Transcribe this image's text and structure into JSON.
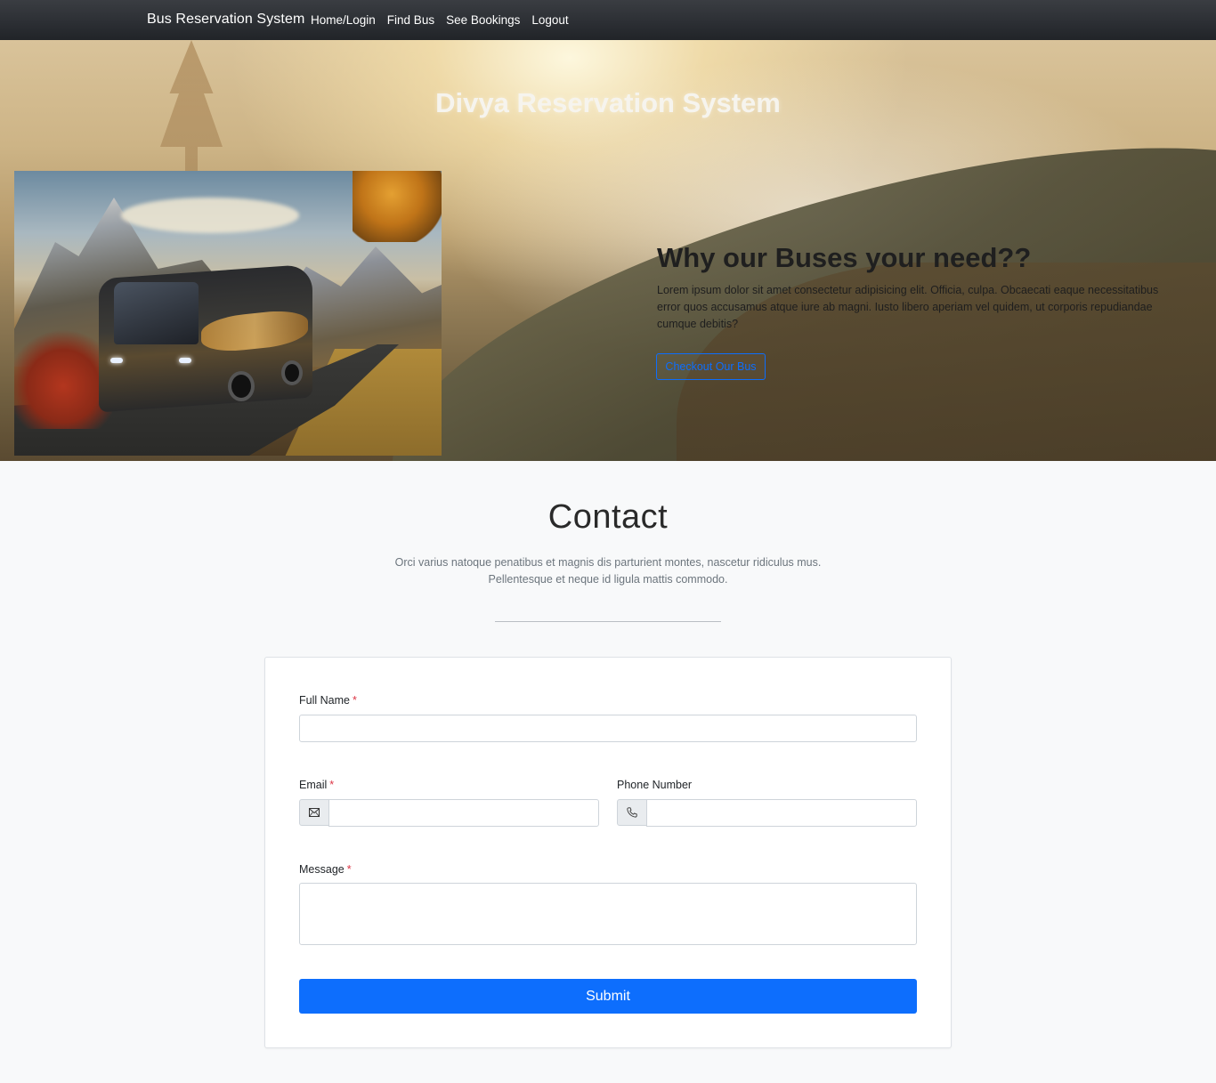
{
  "navbar": {
    "brand": "Bus Reservation System",
    "links": [
      "Home/Login",
      "Find Bus",
      "See Bookings",
      "Logout"
    ]
  },
  "hero": {
    "title": "Divya Reservation System",
    "why_title": "Why our Buses your need??",
    "why_text": "Lorem ipsum dolor sit amet consectetur adipisicing elit. Officia, culpa. Obcaecati eaque necessitatibus error quos accusamus atque iure ab magni. Iusto libero aperiam vel quidem, ut corporis repudiandae cumque debitis?",
    "button_label": "Checkout Our Bus"
  },
  "contact": {
    "title": "Contact",
    "subtitle_line1": "Orci varius natoque penatibus et magnis dis parturient montes, nascetur ridiculus mus.",
    "subtitle_line2": "Pellentesque et neque id ligula mattis commodo.",
    "form": {
      "full_name_label": "Full Name",
      "email_label": "Email",
      "phone_label": "Phone Number",
      "message_label": "Message",
      "required_mark": "*",
      "full_name_value": "",
      "email_value": "",
      "phone_value": "",
      "message_value": "",
      "submit_label": "Submit"
    }
  },
  "colors": {
    "primary": "#0d6efd",
    "required": "#dc3545",
    "navbar": "#2b2e33"
  },
  "icons": {
    "email": "envelope-icon",
    "phone": "phone-icon"
  }
}
